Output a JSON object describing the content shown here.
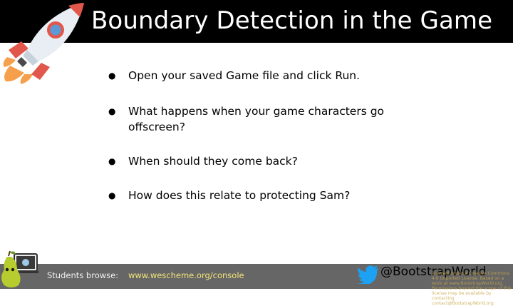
{
  "slide": {
    "title": "Boundary Detection in the Game",
    "bullets": [
      "Open your saved Game file and click Run.",
      "What happens when your game characters go offscreen?",
      "When should they come back?",
      "How does this relate to protecting Sam?"
    ]
  },
  "footer": {
    "students_label": "Students browse:",
    "url": "www.wescheme.org/console",
    "twitter_handle": "@BootstrapWorld",
    "license_lines": [
      "licensed under a Creative Commons 4.0 Unported License. Based on a work at www.BootstrapWorld.org. Permissions beyond the scope of this license may be available by contacting contact@BootstrapWorld.org.",
      ""
    ]
  },
  "icons": {
    "rocket": "rocket-icon",
    "pear": "pear-mascot-icon",
    "twitter": "twitter-bird-icon"
  },
  "colors": {
    "header_bg": "#000000",
    "footer_bg": "#666666",
    "url_color": "#f4e67a",
    "twitter_blue": "#1da1f2"
  }
}
